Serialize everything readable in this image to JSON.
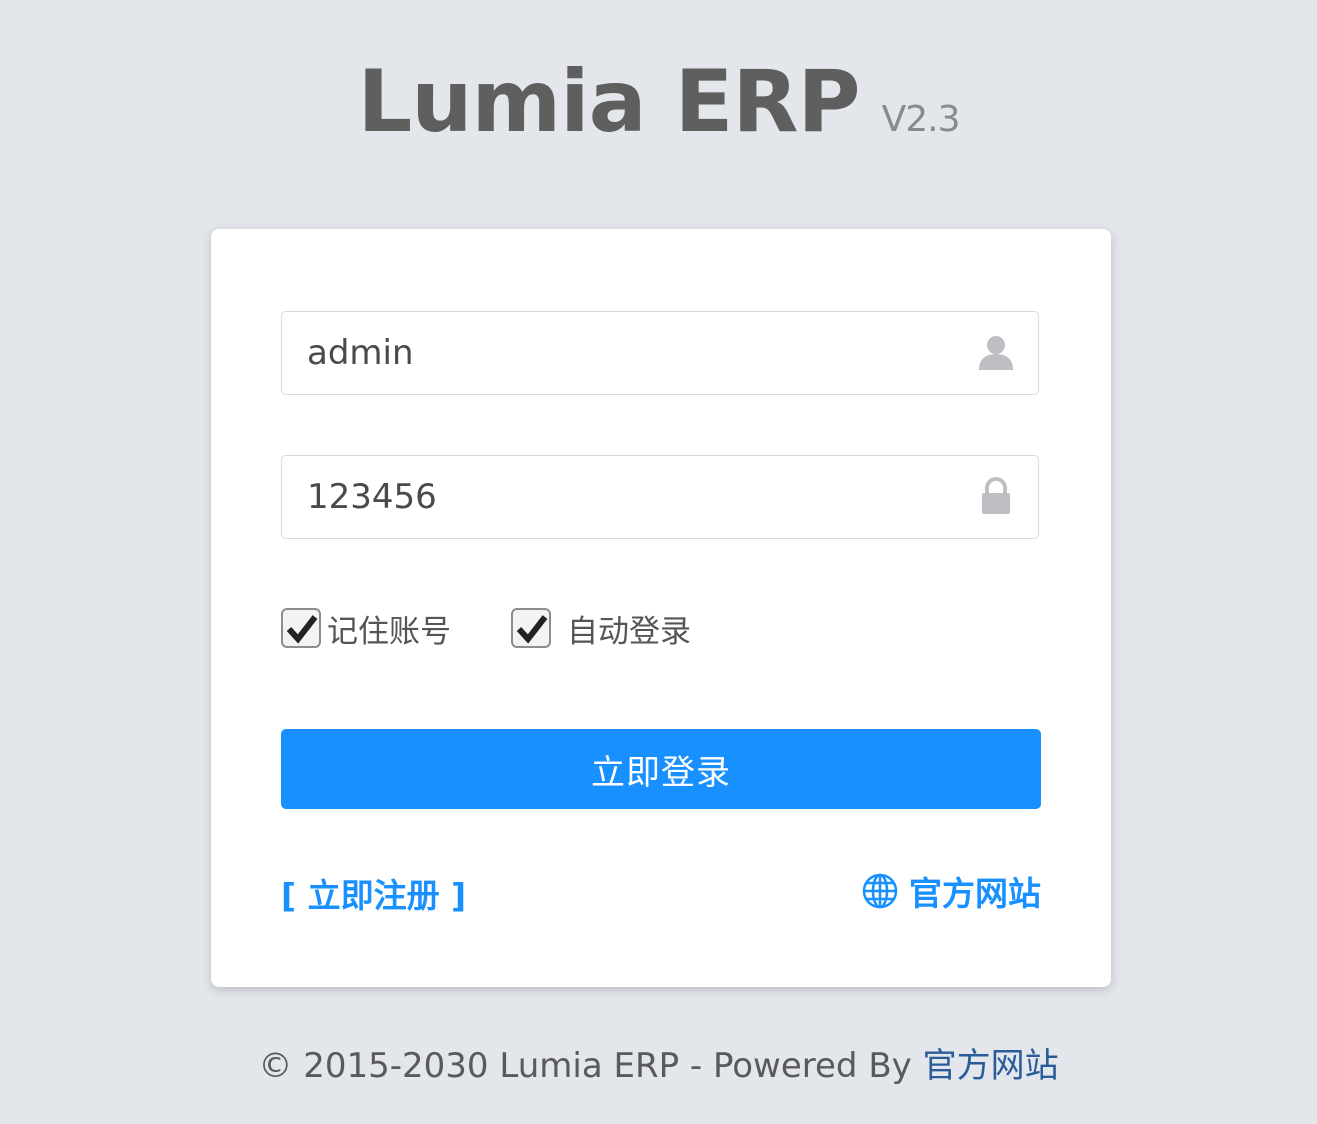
{
  "brand": {
    "name": "Lumia ERP",
    "version": "V2.3"
  },
  "login_form": {
    "username": {
      "value": "admin",
      "icon": "user-icon"
    },
    "password": {
      "value": "123456",
      "icon": "lock-icon"
    },
    "remember_account": {
      "label": "记住账号",
      "checked": true
    },
    "auto_login": {
      "label": "自动登录",
      "checked": true
    },
    "submit_label": "立即登录",
    "register_link": "[ 立即注册 ]",
    "official_site_link": "官方网站",
    "official_site_icon": "globe-icon"
  },
  "footer": {
    "copyright": "© 2015-2030 Lumia ERP - Powered By ",
    "link": "官方网站"
  },
  "colors": {
    "background": "#e3e6eb",
    "primary": "#1890ff",
    "card": "#ffffff",
    "brand_text": "#5f5f5f"
  }
}
